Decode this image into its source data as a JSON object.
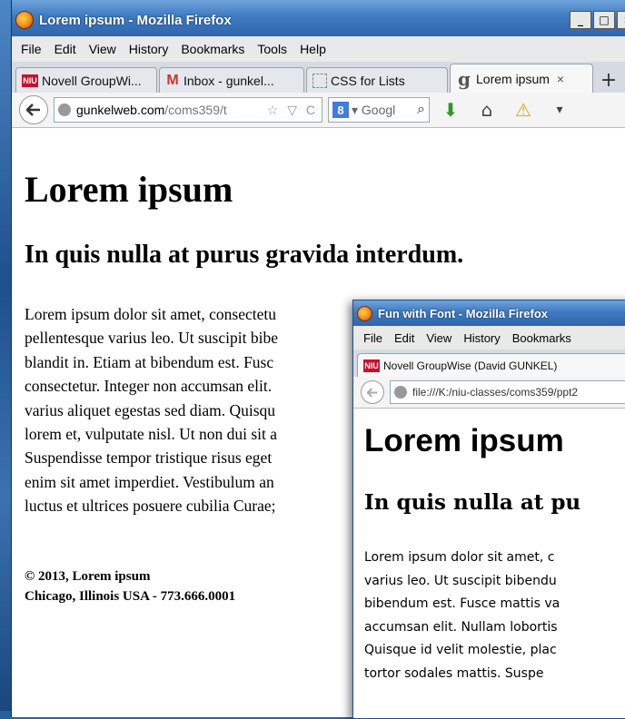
{
  "win1": {
    "title": "Lorem ipsum - Mozilla Firefox",
    "winbtns": [
      "_",
      "□",
      "×"
    ],
    "menu": [
      "File",
      "Edit",
      "View",
      "History",
      "Bookmarks",
      "Tools",
      "Help"
    ],
    "tabs": [
      {
        "label": "Novell GroupWi...",
        "favicon": "NIU"
      },
      {
        "label": "Inbox - gunkel...",
        "favicon": "M"
      },
      {
        "label": "CSS for Lists",
        "favicon": ""
      },
      {
        "label": "Lorem ipsum",
        "favicon": "g",
        "close": "×"
      }
    ],
    "newtab": "+",
    "url_host": "gunkelweb.com",
    "url_path": "/coms359/t",
    "url_tools": "☆ ▽ C",
    "search_engine": "8",
    "search_placeholder": "▾ Googl",
    "search_icon": "⌕",
    "tools": [
      "⬇",
      "⌂",
      "⚠",
      "▾"
    ],
    "heading": "Lorem ipsum",
    "subheading": "In quis nulla at purus gravida interdum.",
    "paragraph_lines": [
      "Lorem ipsum dolor sit amet, consectetu",
      "pellentesque varius leo. Ut suscipit bibe",
      "blandit in. Etiam at bibendum est. Fusc",
      "consectetur. Integer non accumsan elit.",
      "varius aliquet egestas sed diam. Quisqu",
      "lorem et, vulputate nisl. Ut non dui sit a",
      "Suspendisse tempor tristique risus eget",
      "enim sit amet imperdiet. Vestibulum an",
      "luctus et ultrices posuere cubilia Curae;"
    ],
    "footer_line1": "© 2013, Lorem ipsum",
    "footer_line2": "Chicago, Illinois USA - 773.666.0001"
  },
  "win2": {
    "title": "Fun with Font - Mozilla Firefox",
    "menu": [
      "File",
      "Edit",
      "View",
      "History",
      "Bookmarks"
    ],
    "tab_label": "Novell GroupWise (David GUNKEL)",
    "tab_favicon": "NIU",
    "url": "file:///K:/niu-classes/coms359/ppt2",
    "heading": "Lorem ipsum",
    "subheading": "In quis nulla at pu",
    "paragraph_lines": [
      "Lorem ipsum dolor sit amet, c",
      "varius leo. Ut suscipit bibendu",
      "bibendum est. Fusce mattis va",
      "accumsan elit. Nullam lobortis",
      "Quisque id velit molestie, plac",
      "tortor sodales mattis. Suspe"
    ]
  },
  "colors": {
    "titlebar": "#3f7ac0",
    "niu_red": "#c8102e",
    "desktop": "#2a5f9e"
  }
}
